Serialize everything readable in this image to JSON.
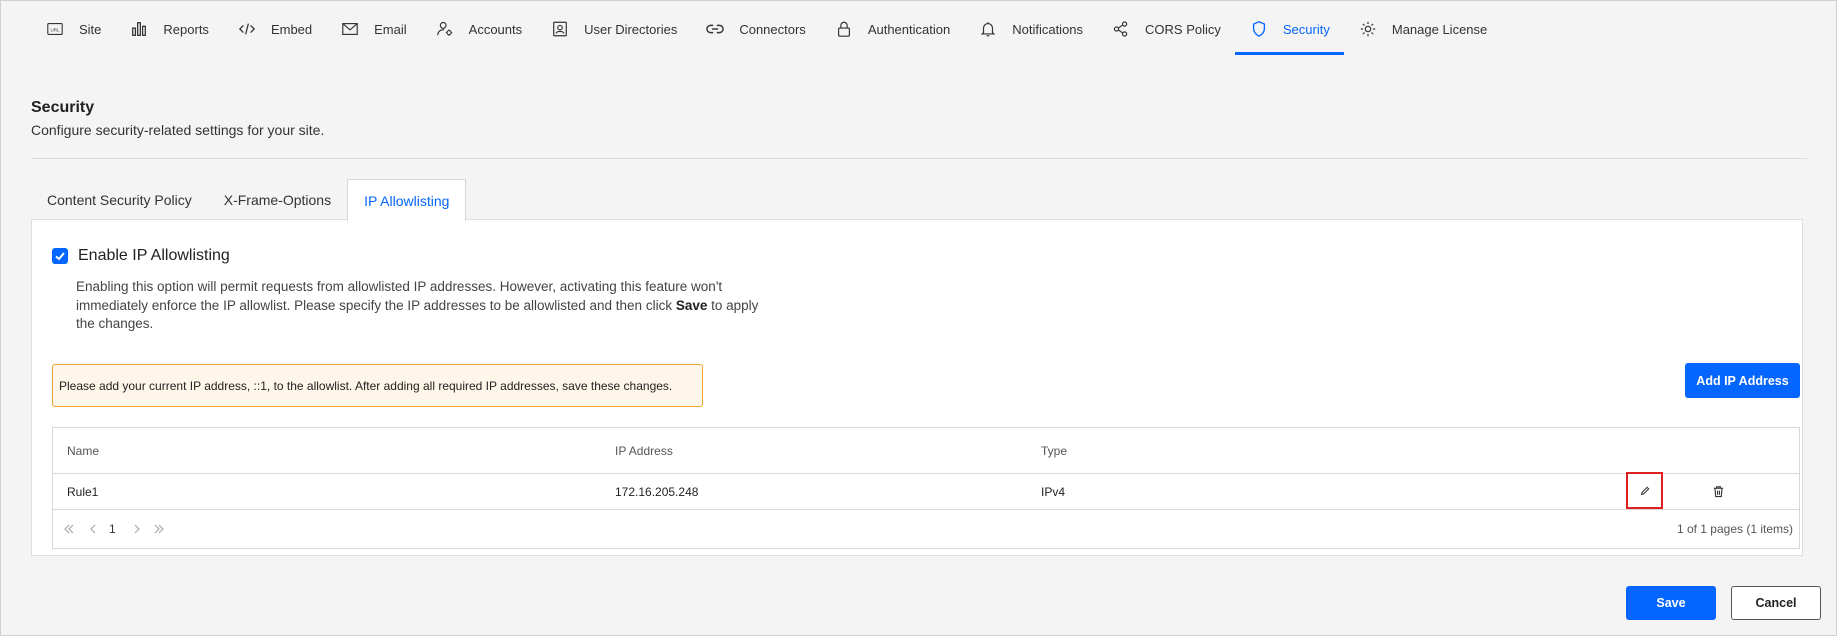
{
  "nav": {
    "items": [
      {
        "label": "Site",
        "icon": "url-icon"
      },
      {
        "label": "Reports",
        "icon": "bar-chart-icon"
      },
      {
        "label": "Embed",
        "icon": "code-icon"
      },
      {
        "label": "Email",
        "icon": "mail-icon"
      },
      {
        "label": "Accounts",
        "icon": "user-gear-icon"
      },
      {
        "label": "User Directories",
        "icon": "contact-card-icon"
      },
      {
        "label": "Connectors",
        "icon": "link-icon"
      },
      {
        "label": "Authentication",
        "icon": "lock-icon"
      },
      {
        "label": "Notifications",
        "icon": "bell-icon"
      },
      {
        "label": "CORS Policy",
        "icon": "share-icon"
      },
      {
        "label": "Security",
        "icon": "shield-icon"
      },
      {
        "label": "Manage License",
        "icon": "gear-badge-icon"
      }
    ],
    "active": "Security",
    "active_color": "#0565ff"
  },
  "page": {
    "title": "Security",
    "description": "Configure security-related settings for your site."
  },
  "subtabs": {
    "items": [
      "Content Security Policy",
      "X-Frame-Options",
      "IP Allowlisting"
    ],
    "active": "IP Allowlisting"
  },
  "allowlist": {
    "enable_label": "Enable IP Allowlisting",
    "enabled": true,
    "help_part1": "Enabling this option will permit requests from allowlisted IP addresses. However, activating this feature won't immediately enforce the IP allowlist. Please specify the IP addresses to be allowlisted and then click ",
    "help_bold": "Save",
    "help_part2": " to apply the changes.",
    "warning": "Please add your current IP address, ::1, to the allowlist. After adding all required IP addresses, save these changes.",
    "add_button": "Add IP Address"
  },
  "grid": {
    "columns": [
      "Name",
      "IP Address",
      "Type"
    ],
    "rows": [
      {
        "name": "Rule1",
        "ip": "172.16.205.248",
        "type": "IPv4"
      }
    ],
    "pager": {
      "current_page": "1",
      "info": "1 of 1 pages (1 items)"
    }
  },
  "footer": {
    "save_label": "Save",
    "cancel_label": "Cancel"
  }
}
